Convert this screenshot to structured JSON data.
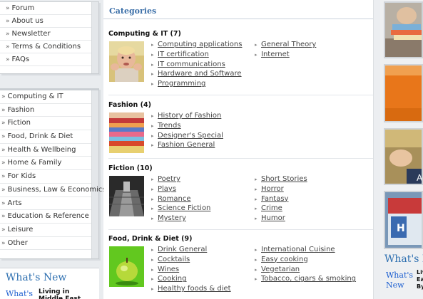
{
  "top_nav": [
    "Forum",
    "About us",
    "Newsletter",
    "Terms & Conditions",
    "FAQs"
  ],
  "category_nav": [
    "Computing & IT",
    "Fashion",
    "Fiction",
    "Food, Drink & Diet",
    "Health & Wellbeing",
    "Home & Family",
    "For Kids",
    "Business, Law & Economics",
    "Arts",
    "Education & Reference",
    "Leisure",
    "Other"
  ],
  "whats_new": {
    "title": "What's New",
    "small_label": "What's",
    "item_title": "Living in Middle East"
  },
  "categories_header": "Categories",
  "sections": [
    {
      "title": "Computing & IT (7)",
      "col1": [
        "Computing applications",
        "IT certification",
        "IT communications",
        "Hardware and Software",
        "Programming"
      ],
      "col2": [
        "General Theory",
        "Internet"
      ]
    },
    {
      "title": "Fashion (4)",
      "col1": [
        "History of Fashion",
        "Trends",
        "Designer's Special",
        "Fashion General"
      ],
      "col2": []
    },
    {
      "title": "Fiction (10)",
      "col1": [
        "Poetry",
        "Plays",
        "Romance",
        "Science Fiction",
        "Mystery"
      ],
      "col2": [
        "Short Stories",
        "Horror",
        "Fantasy",
        "Crime",
        "Humor"
      ]
    },
    {
      "title": "Food, Drink & Diet (9)",
      "col1": [
        "Drink General",
        "Cocktails",
        "Wines",
        "Cooking",
        "Healthy foods & diet"
      ],
      "col2": [
        "International Cuisine",
        "Easy cooking",
        "Vegetarian",
        "Tobacco, cigars & smoking"
      ]
    }
  ],
  "right_column": {
    "tile4_label": "H",
    "tile3_label": "A",
    "whats_new_label": "What's Ne",
    "whats_new_small": [
      "What's",
      "New"
    ],
    "whats_new_item": [
      "Liv",
      "Ea",
      "By"
    ]
  },
  "colors": {
    "accent_blue": "#2d6fb0",
    "header_blue": "#3b6fa8"
  }
}
